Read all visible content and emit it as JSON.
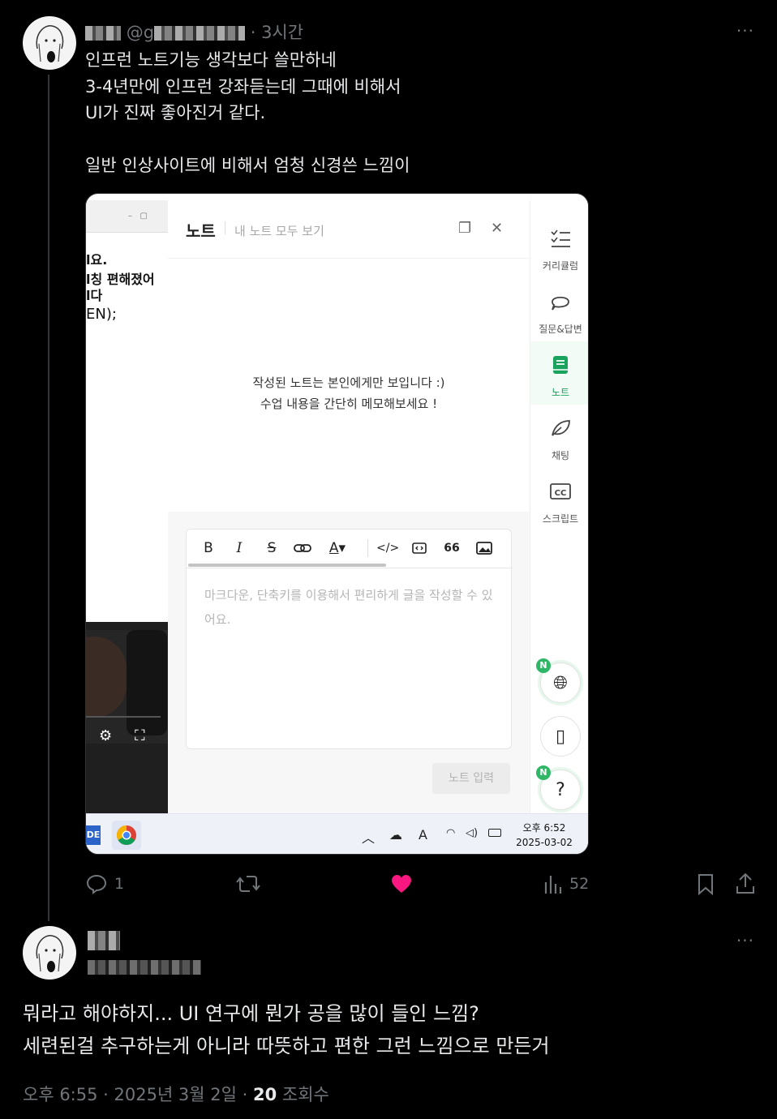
{
  "tweet1": {
    "handle": "@g",
    "time": "· 3시간",
    "lines": [
      "인프런 노트기능 생각보다 쓸만하네",
      "3-4년만에 인프런 강좌듣는데 그때에 비해서",
      "UI가 진짜 좋아진거 같다.",
      "일반 인상사이트에 비해서 엄청 신경쓴 느낌이"
    ],
    "more": "···",
    "media": {
      "video": {
        "code_lines": [
          "l요.",
          "l칭 편해졌어",
          "l다",
          "EN);"
        ]
      },
      "note": {
        "title": "노트",
        "view_all": "내 노트 모두 보기",
        "empty_line1": "작성된 노트는 본인에게만 보입니다 :)",
        "empty_line2": "수업 내용을 간단히 메모해보세요 !",
        "toolbar": [
          "B",
          "I",
          "S",
          "link",
          "A",
          "code",
          "codeblock",
          "66",
          "image"
        ],
        "placeholder": "마크다운, 단축키를 이용해서 편리하게 글을 작성할 수 있어요.",
        "submit": "노트 입력"
      },
      "nav": [
        {
          "label": "커리큘럼",
          "icon": "curriculum-icon"
        },
        {
          "label": "질문&답변",
          "icon": "chat-bubble-icon"
        },
        {
          "label": "노트",
          "icon": "note-icon"
        },
        {
          "label": "채팅",
          "icon": "leaf-icon"
        },
        {
          "label": "스크립트",
          "icon": "cc-icon"
        }
      ],
      "badge": "N",
      "help": "?",
      "taskbar": {
        "app_label": "DE",
        "clock_line1": "오후 6:52",
        "clock_line2": "2025-03-02"
      }
    },
    "actions": {
      "replies": "1",
      "views": "52"
    },
    "colors": {
      "like": "#f91880",
      "accent_green": "#1aa35d"
    }
  },
  "tweet2": {
    "more": "···",
    "lines": [
      "뭐라고 해야하지... UI 연구에 뭔가 공을 많이 들인 느낌?",
      "세련된걸 추구하는게 아니라 따뜻하고 편한 그런 느낌으로 만든거"
    ],
    "meta_prefix": "오후 6:55 · 2025년 3월 2일 · ",
    "views_count": "20",
    "views_label": " 조회수"
  }
}
